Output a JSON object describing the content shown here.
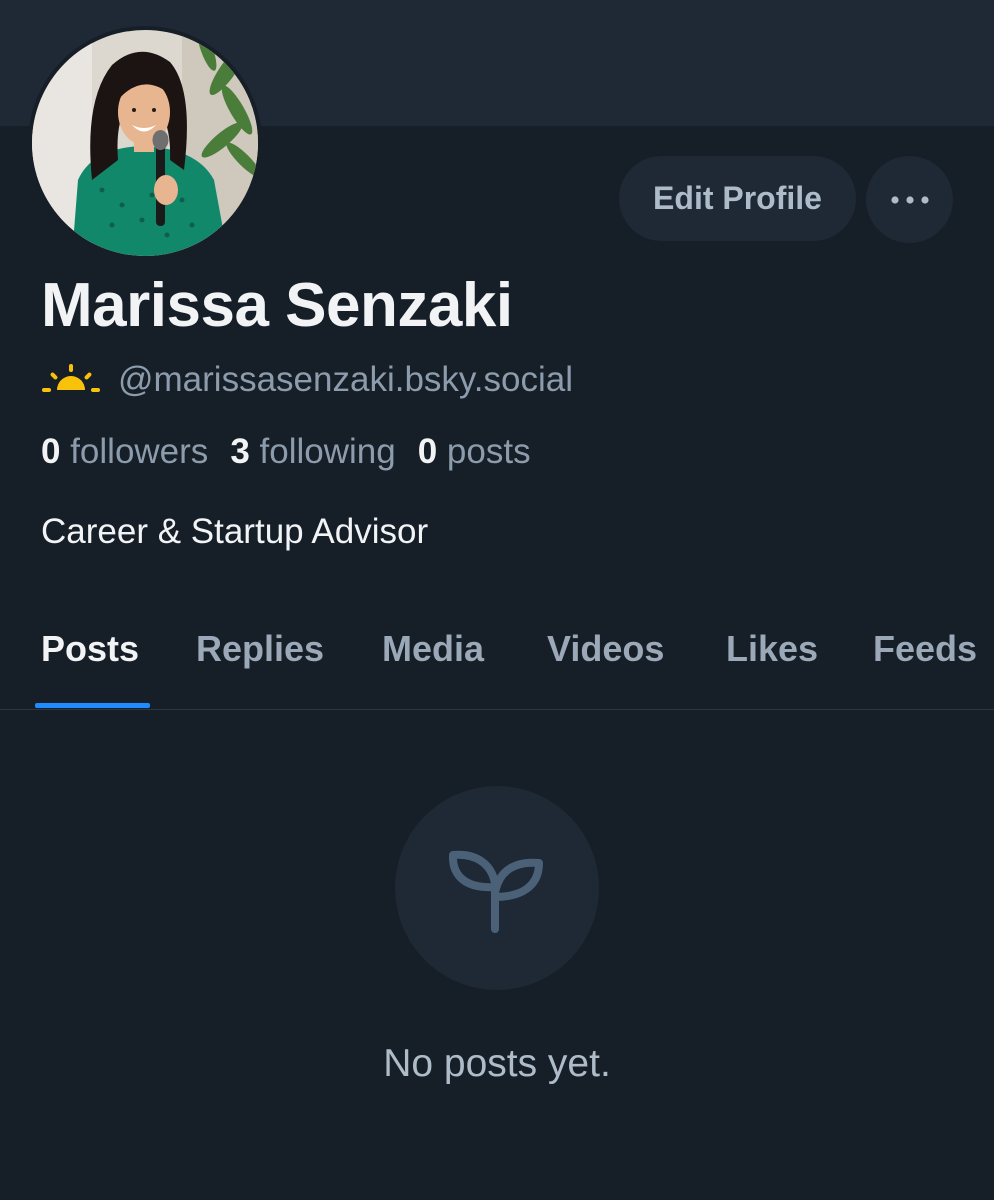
{
  "profile": {
    "display_name": "Marissa Senzaki",
    "handle": "@marissasenzaki.bsky.social",
    "bio": "Career & Startup Advisor",
    "avatar_icon": "profile-photo"
  },
  "stats": {
    "followers_count": "0",
    "followers_label": "followers",
    "following_count": "3",
    "following_label": "following",
    "posts_count": "0",
    "posts_label": "posts"
  },
  "actions": {
    "edit_profile_label": "Edit Profile",
    "more_icon": "ellipsis-icon"
  },
  "tabs": [
    {
      "label": "Posts",
      "active": true
    },
    {
      "label": "Replies",
      "active": false
    },
    {
      "label": "Media",
      "active": false
    },
    {
      "label": "Videos",
      "active": false
    },
    {
      "label": "Likes",
      "active": false
    },
    {
      "label": "Feeds",
      "active": false
    }
  ],
  "empty_state": {
    "icon": "sprout-icon",
    "message": "No posts yet."
  },
  "colors": {
    "background": "#161e27",
    "banner": "#1e2935",
    "accent": "#208bfe",
    "muted_text": "#8d9cac"
  }
}
